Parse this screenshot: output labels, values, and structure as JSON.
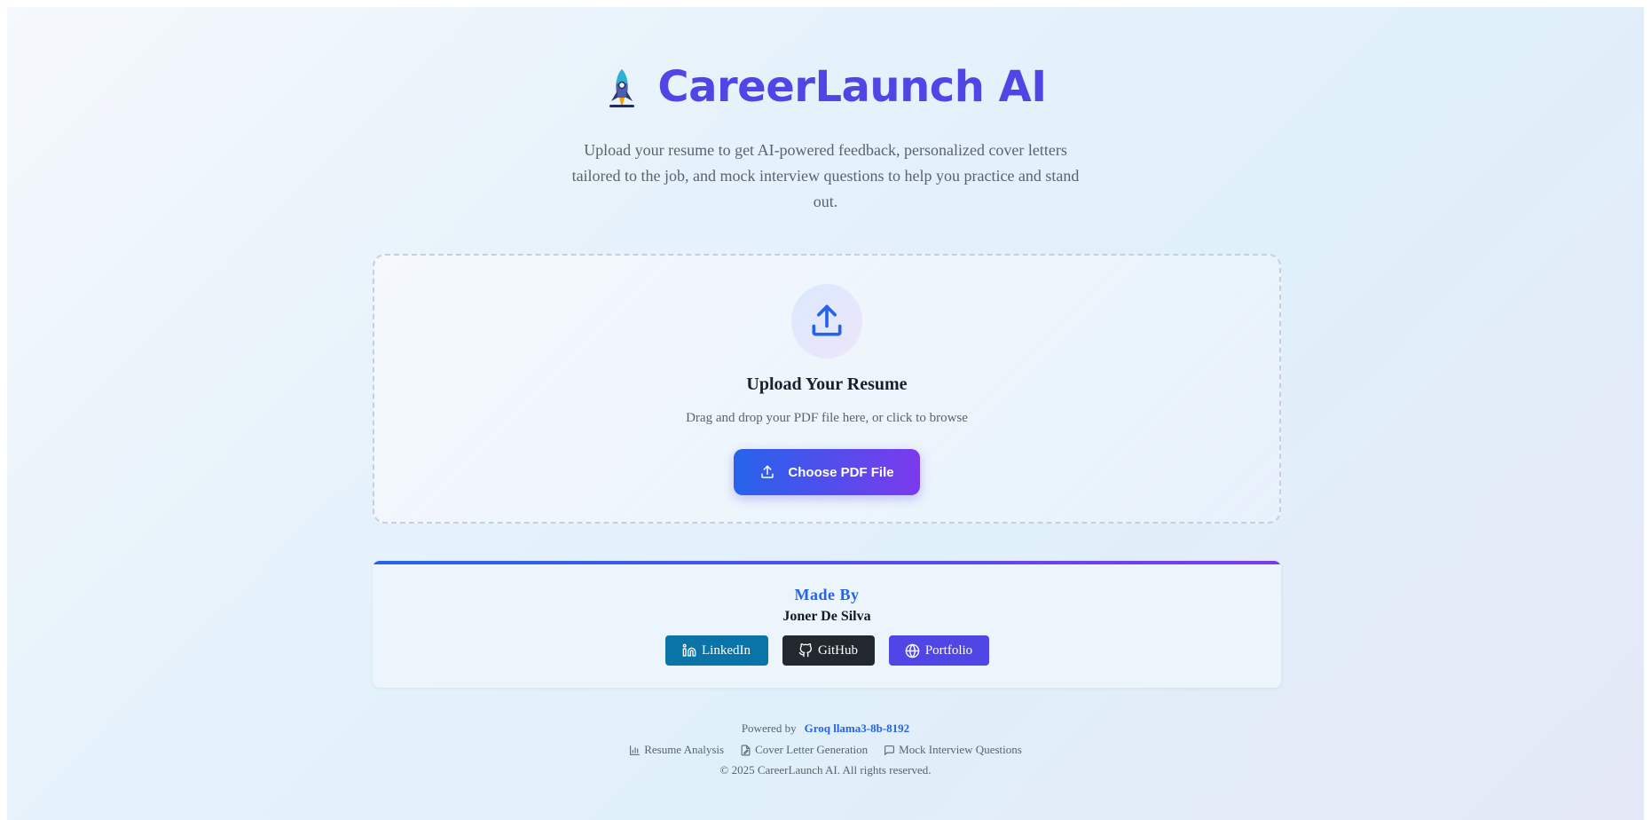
{
  "app": {
    "title": "CareerLaunch AI",
    "logo_icon": "rocket-icon",
    "subtitle": "Upload your resume to get AI-powered feedback, personalized cover letters tailored to the job, and mock interview questions to help you practice and stand out."
  },
  "upload": {
    "icon": "upload-icon",
    "title": "Upload Your Resume",
    "hint": "Drag and drop your PDF file here, or click to browse",
    "button_label": "Choose PDF File"
  },
  "made_by": {
    "label": "Made By",
    "name": "Joner De Silva",
    "links": {
      "linkedin": "LinkedIn",
      "github": "GitHub",
      "portfolio": "Portfolio"
    }
  },
  "footer": {
    "powered_label": "Powered by",
    "model": "Groq llama3-8b-8192",
    "features": {
      "analysis": "Resume Analysis",
      "cover_letter": "Cover Letter Generation",
      "interview": "Mock Interview Questions"
    },
    "copyright": "© 2025 CareerLaunch AI. All rights reserved."
  },
  "colors": {
    "brand": "#4f46e5",
    "accent_blue": "#2563eb",
    "accent_purple": "#7c3aed",
    "linkedin": "#0a73a8",
    "github": "#23272e"
  }
}
